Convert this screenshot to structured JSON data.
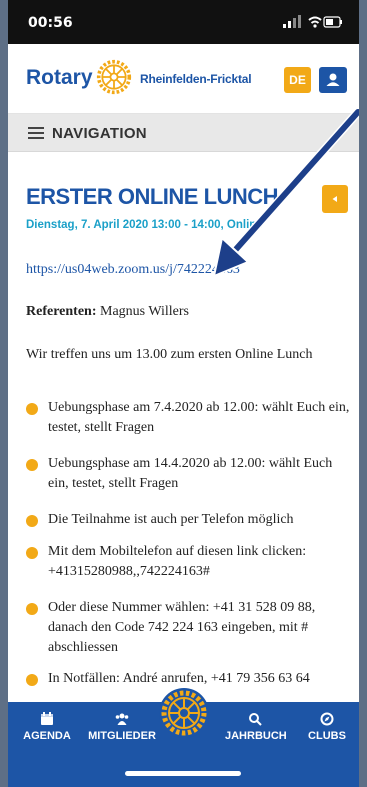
{
  "status": {
    "time": "00:56"
  },
  "header": {
    "logo_text": "Rotary",
    "club_name": "Rheinfelden-Fricktal",
    "lang_button": "DE",
    "user_icon": "user-icon"
  },
  "navbar": {
    "label": "NAVIGATION",
    "icon": "hamburger-icon"
  },
  "event": {
    "title": "ERSTER ONLINE LUNCH",
    "date": "Dienstag, 7. April 2020 13:00 - 14:00, Online",
    "link": "https://us04web.zoom.us/j/742224163",
    "referenten_label": "Referenten:",
    "referenten_value": " Magnus Willers",
    "intro": "Wir treffen uns um 13.00 zum ersten Online Lunch",
    "bullets": [
      "Uebungsphase am 7.4.2020 ab 12.00: wählt Euch ein, testet, stellt Fragen",
      "Uebungsphase am 14.4.2020 ab 12.00: wählt Euch ein, testet, stellt Fragen",
      "Die Teilnahme ist auch per Telefon möglich",
      "Mit dem Mobiltelefon auf diesen link clicken: +41315280988,,742224163#",
      "Oder diese Nummer wählen: +41 31 528 09 88, danach den Code 742 224 163 eingeben, mit # abschliessen",
      "In Notfällen: André anrufen, +41 79 356 63 64"
    ]
  },
  "tabbar": {
    "agenda": "AGENDA",
    "mitglieder": "MITGLIEDER",
    "jahrbuch": "JAHRBUCH",
    "clubs": "CLUBS"
  },
  "colors": {
    "brand_blue": "#1d55a6",
    "accent_gold": "#f2a917",
    "date_teal": "#1ba0c8"
  }
}
